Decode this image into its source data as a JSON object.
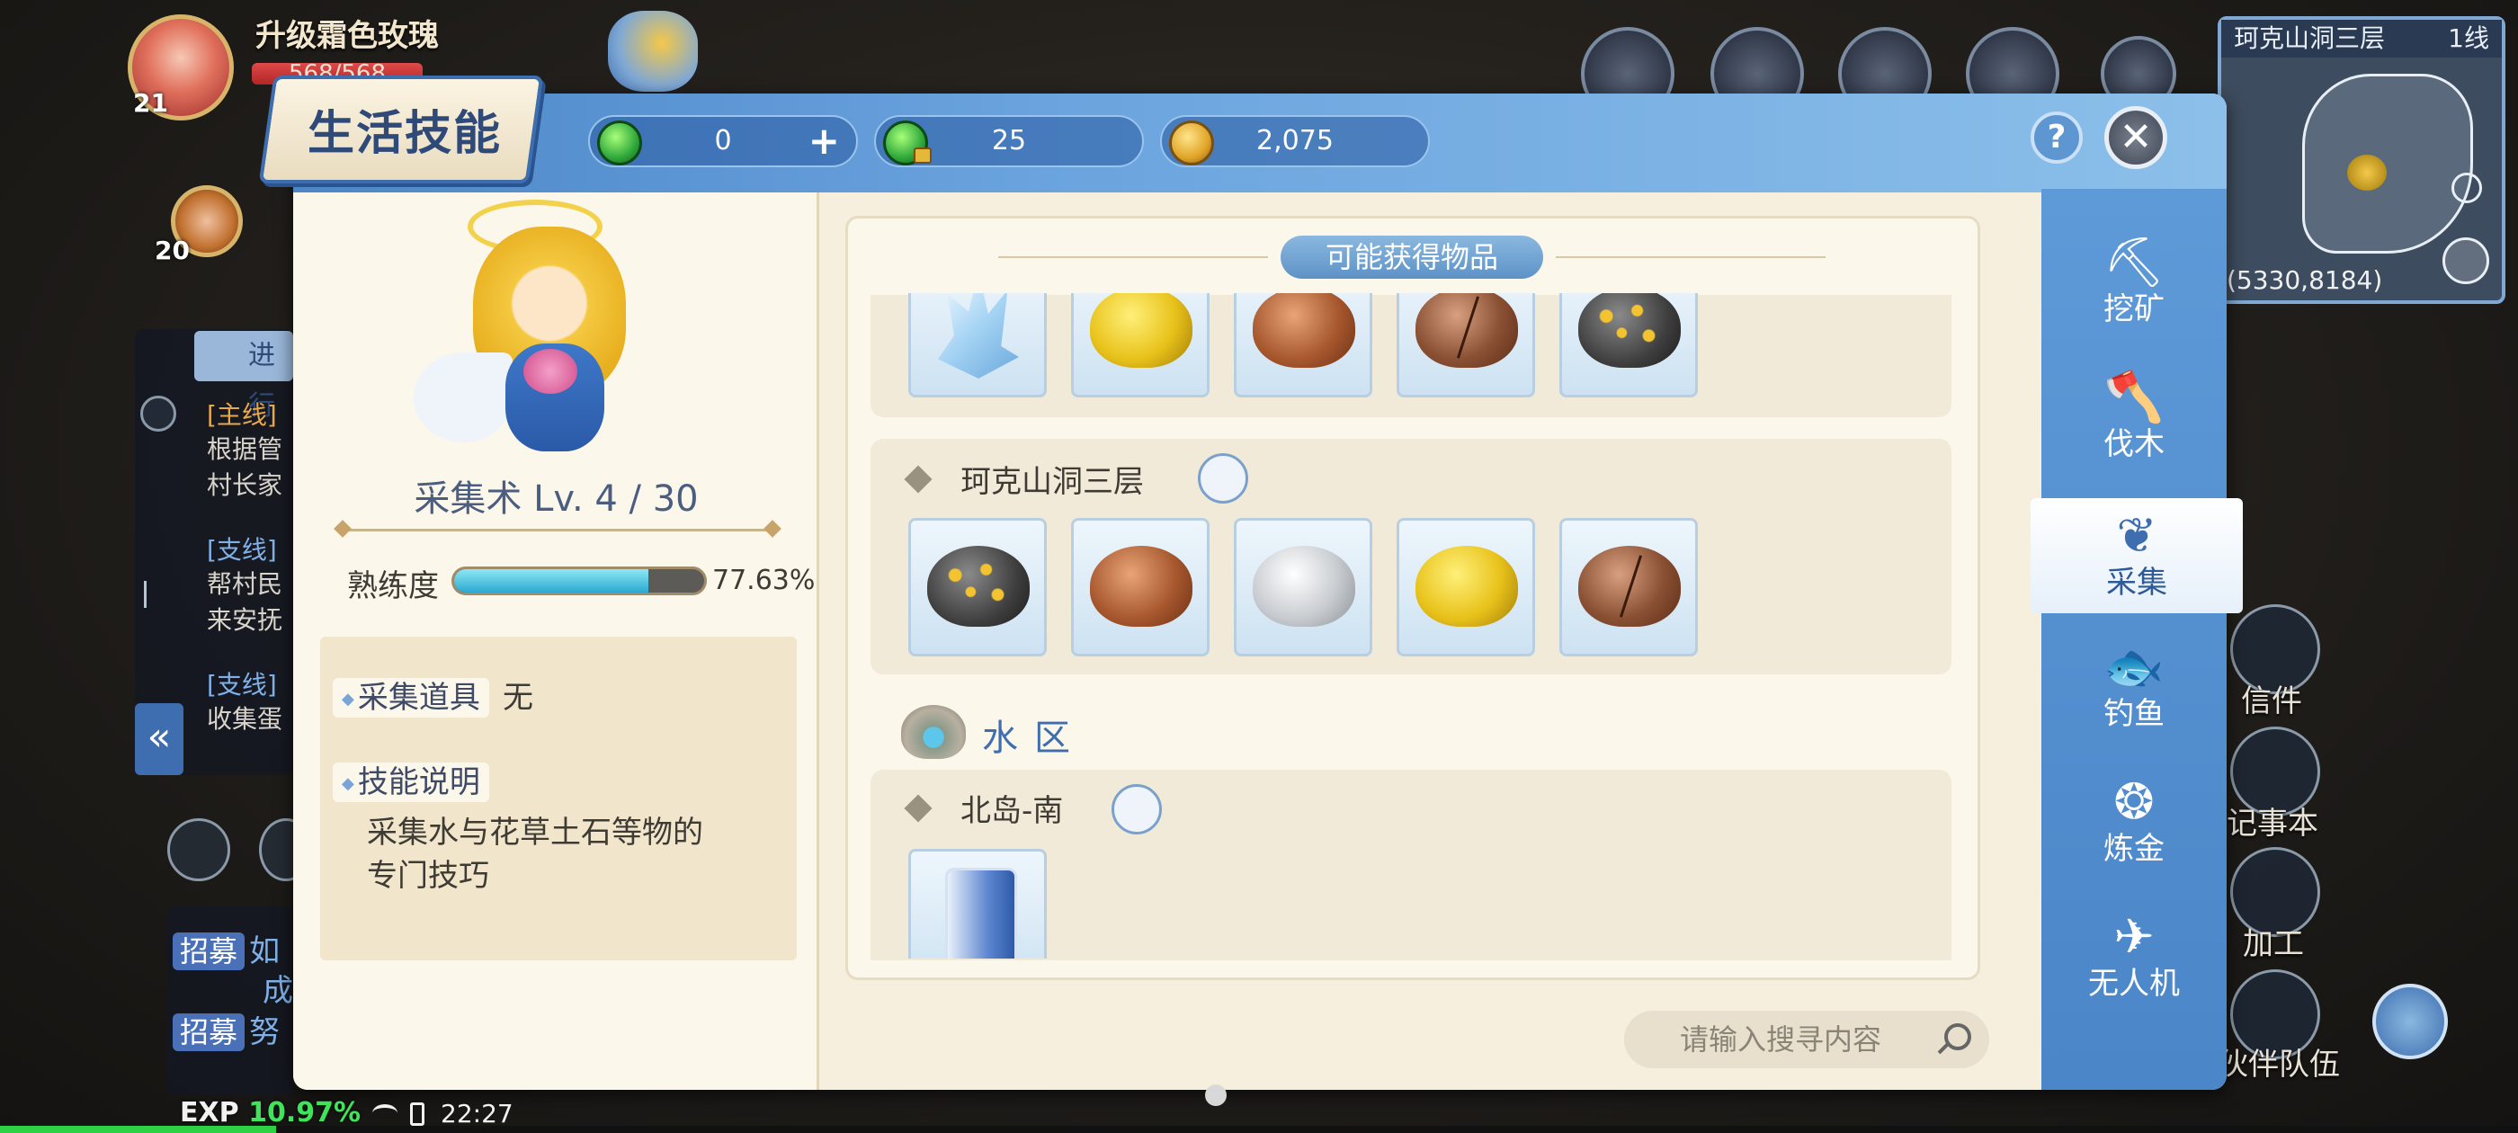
{
  "player": {
    "name": "升级霜色玫瑰",
    "level": "21",
    "hp": "568/568",
    "hp_fraction": 1.0
  },
  "partner": {
    "level": "20"
  },
  "quests": {
    "tab_label": "进行",
    "items": [
      {
        "tag": "[主线]",
        "lines": [
          "根据管",
          "村长家"
        ]
      },
      {
        "tag": "[支线]",
        "lines": [
          "帮村民",
          "来安抚"
        ]
      },
      {
        "tag": "[支线]",
        "lines": [
          "收集蛋"
        ]
      }
    ]
  },
  "recruit": [
    {
      "tag": "招募",
      "text": "如"
    },
    {
      "tag": "招募",
      "text": "努"
    }
  ],
  "recruit_extra": "成",
  "minimap": {
    "title": "珂克山洞三层",
    "line": "1线",
    "coord": "(5330,8184)"
  },
  "right_hud": [
    {
      "icon": "mail-icon",
      "label": "信件"
    },
    {
      "icon": "notebook-icon",
      "label": "记事本"
    },
    {
      "icon": "anvil-icon",
      "label": "加工"
    },
    {
      "icon": "party-icon",
      "label": "伙伴队伍"
    }
  ],
  "dialog": {
    "title": "生活技能",
    "currencies": [
      {
        "icon": "green-gem-icon",
        "value": "0",
        "has_plus": true
      },
      {
        "icon": "locked-gem-icon",
        "value": "25"
      },
      {
        "icon": "gold-coin-icon",
        "value": "2,075"
      }
    ],
    "help_label": "?",
    "close_label": "✕"
  },
  "skill": {
    "title": "采集术 Lv. 4 / 30",
    "proficiency_label": "熟练度",
    "proficiency_value": "77.63%",
    "proficiency_fraction": 0.7763,
    "tool_label": "采集道具",
    "tool_value": "无",
    "desc_label": "技能说明",
    "desc_lines": [
      "采集水与花草土石等物的",
      "专门技巧"
    ]
  },
  "obtainable": {
    "header": "可能获得物品",
    "top_row": [
      "crystal",
      "gold",
      "copper",
      "broken",
      "ore"
    ],
    "zones": [
      {
        "name": "珂克山洞三层",
        "items": [
          "ore",
          "copper",
          "silver",
          "gold",
          "broken"
        ]
      },
      {
        "name": "北岛-南",
        "items": [
          "water-jug"
        ]
      }
    ],
    "water_section": "水区"
  },
  "search": {
    "placeholder": "请输入搜寻内容"
  },
  "tabs": [
    {
      "icon": "pickaxe-icon",
      "glyph": "⛏",
      "label": "挖矿"
    },
    {
      "icon": "axe-icon",
      "glyph": "🪓",
      "label": "伐木"
    },
    {
      "icon": "herb-icon",
      "glyph": "❦",
      "label": "采集",
      "active": true
    },
    {
      "icon": "fish-icon",
      "glyph": "🐟",
      "label": "钓鱼"
    },
    {
      "icon": "alchemy-icon",
      "glyph": "❂",
      "label": "炼金"
    },
    {
      "icon": "drone-icon",
      "glyph": "✈",
      "label": "无人机"
    }
  ],
  "status": {
    "exp_label": "EXP",
    "exp_pct": "10.97%",
    "exp_fraction": 0.1097,
    "time": "22:27"
  }
}
